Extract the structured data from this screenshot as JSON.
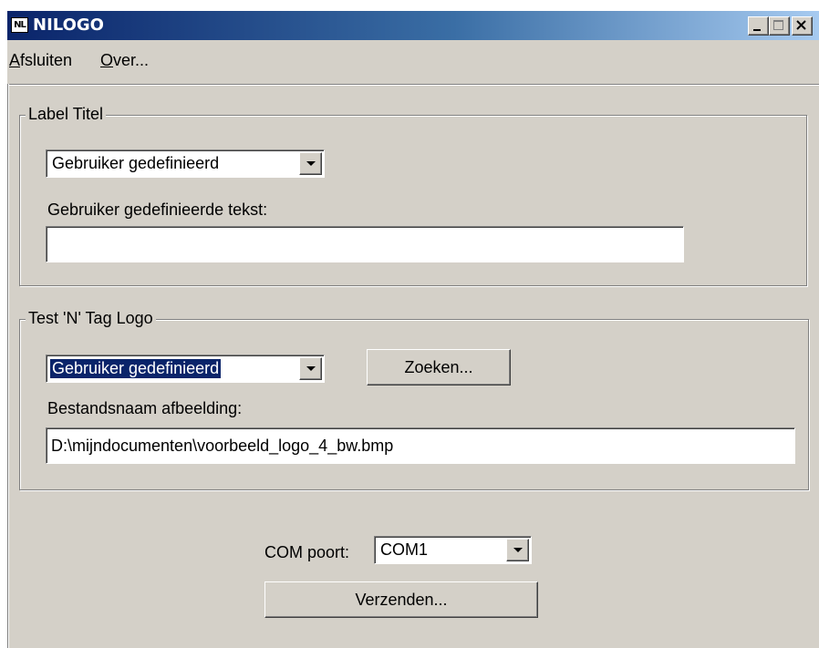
{
  "window": {
    "icon_text": "NL",
    "title": "NILOGO"
  },
  "menu": {
    "items": [
      {
        "accel": "A",
        "rest": "fsluiten"
      },
      {
        "accel": "O",
        "rest": "ver..."
      }
    ]
  },
  "label_group": {
    "title": "Label Titel",
    "select_value": "Gebruiker gedefinieerd",
    "text_label": "Gebruiker gedefinieerde tekst:",
    "text_value": ""
  },
  "logo_group": {
    "title": "Test 'N' Tag Logo",
    "select_value": "Gebruiker gedefinieerd",
    "search_label": "Zoeken...",
    "file_label": "Bestandsnaam afbeelding:",
    "file_value": "D:\\mijndocumenten\\voorbeeld_logo_4_bw.bmp"
  },
  "com": {
    "label": "COM poort:",
    "value": "COM1"
  },
  "send_label": "Verzenden..."
}
